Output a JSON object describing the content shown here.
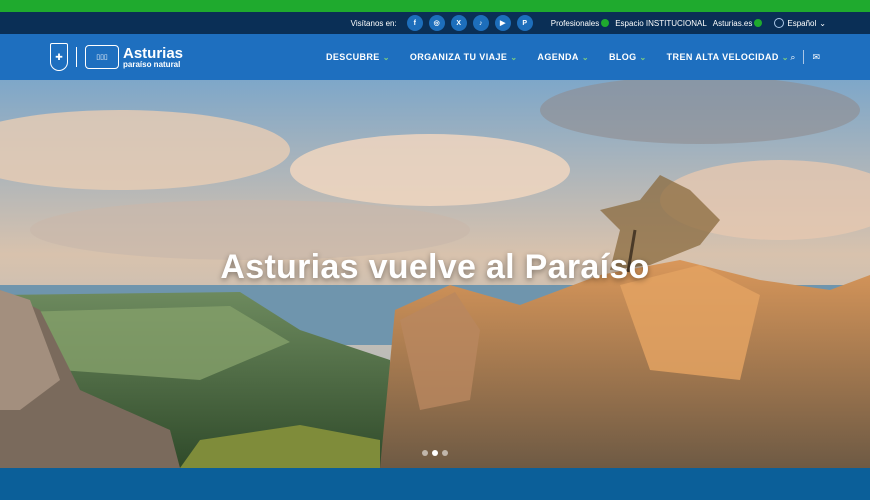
{
  "topbar": {
    "visit_label": "Visítanos en:",
    "social": [
      {
        "icon": "facebook-icon",
        "glyph": "f"
      },
      {
        "icon": "instagram-icon",
        "glyph": "◎"
      },
      {
        "icon": "x-icon",
        "glyph": "X"
      },
      {
        "icon": "tiktok-icon",
        "glyph": "♪"
      },
      {
        "icon": "youtube-icon",
        "glyph": "▶"
      },
      {
        "icon": "pinterest-icon",
        "glyph": "P"
      }
    ],
    "links": [
      "Profesionales",
      "Espacio INSTITUCIONAL",
      "Asturias.es"
    ],
    "language": "Español"
  },
  "brand": {
    "name": "Asturias",
    "subtitle": "paraíso natural"
  },
  "nav": {
    "items": [
      "DESCUBRE",
      "ORGANIZA TU VIAJE",
      "AGENDA",
      "BLOG",
      "TREN ALTA VELOCIDAD"
    ]
  },
  "hero": {
    "title": "Asturias vuelve al Paraíso",
    "slide_count": 3,
    "active_slide": 2
  },
  "colors": {
    "green": "#1faa2e",
    "topbar": "#0a2f56",
    "nav": "#1e6fbf"
  }
}
